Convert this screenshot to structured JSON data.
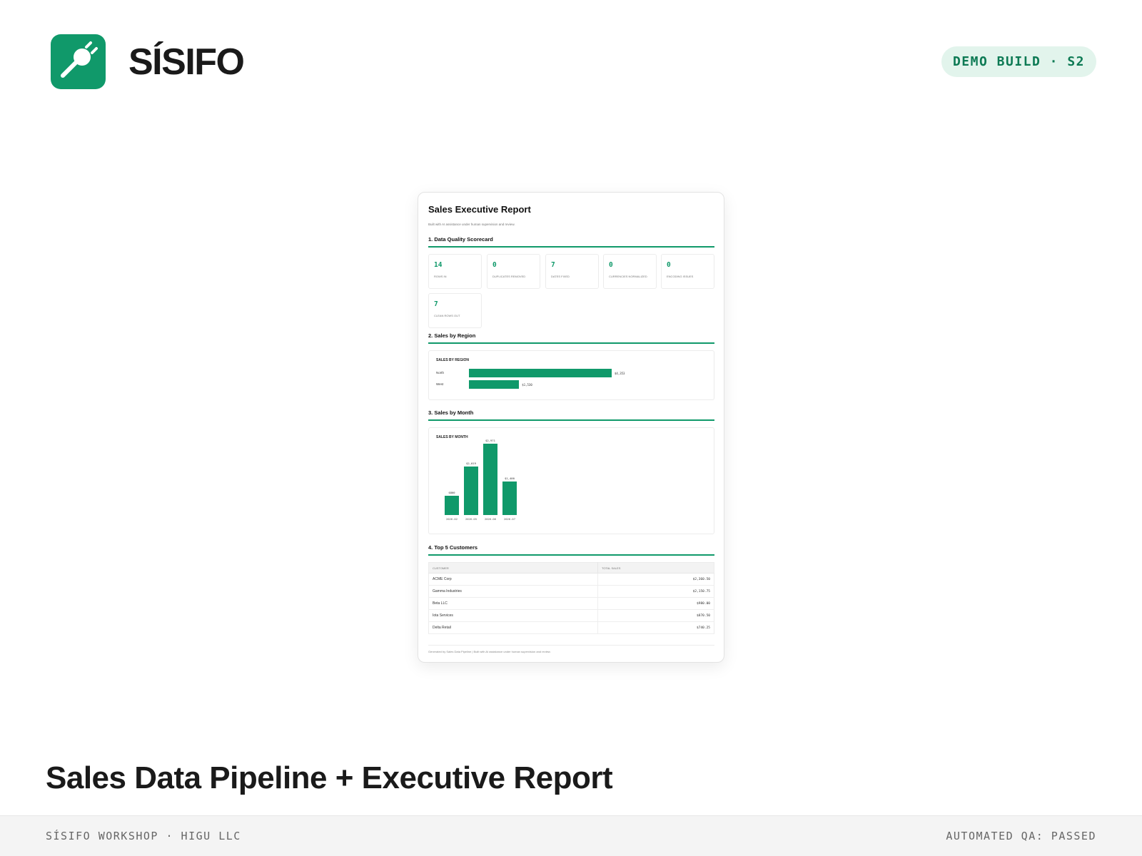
{
  "header": {
    "logo_icon": "plug-icon",
    "brand": "SÍSIFO",
    "badge": "DEMO BUILD · S2",
    "accent": "#10996a"
  },
  "report": {
    "title": "Sales Executive Report",
    "subtitle": "Built with AI assistance under human supervision and review.",
    "sections": {
      "s1": "1. Data Quality Scorecard",
      "s2": "2. Sales by Region",
      "s3": "3. Sales by Month",
      "s4": "4. Top 5 Customers"
    },
    "scorecard": [
      {
        "value": "14",
        "label": "Rows in"
      },
      {
        "value": "0",
        "label": "Duplicates removed"
      },
      {
        "value": "7",
        "label": "Dates fixed"
      },
      {
        "value": "0",
        "label": "Currencies normalized"
      },
      {
        "value": "0",
        "label": "Encoding issues"
      },
      {
        "value": "7",
        "label": "Clean rows out"
      }
    ],
    "customers": {
      "headers": [
        "Customer",
        "Total Sales"
      ],
      "rows": [
        [
          "ACME Corp",
          "$2,360.50"
        ],
        [
          "Gamma Industries",
          "$2,150.75"
        ],
        [
          "Beta LLC",
          "$980.00"
        ],
        [
          "Iota Services",
          "$870.50"
        ],
        [
          "Delta Retail",
          "$740.25"
        ]
      ]
    },
    "footer": "Generated by Sales Data Pipeline | Built with AI assistance under human supervision and review."
  },
  "chart_data": [
    {
      "type": "bar",
      "orientation": "horizontal",
      "title": "SALES BY REGION",
      "categories": [
        "North",
        "West"
      ],
      "values": [
        4353,
        1530
      ],
      "labels": [
        "$4,353",
        "$1,530"
      ]
    },
    {
      "type": "bar",
      "orientation": "vertical",
      "title": "SALES BY MONTH",
      "categories": [
        "2026-02",
        "2026-05",
        "2026-06",
        "2026-07"
      ],
      "values": [
        800,
        2019,
        2971,
        1400
      ],
      "labels": [
        "$800",
        "$2,019",
        "$2,971",
        "$1,400"
      ]
    }
  ],
  "caption": "Sales Data Pipeline + Executive Report",
  "footer": {
    "left": "SÍSIFO WORKSHOP · HIGU LLC",
    "right": "AUTOMATED QA: PASSED"
  }
}
